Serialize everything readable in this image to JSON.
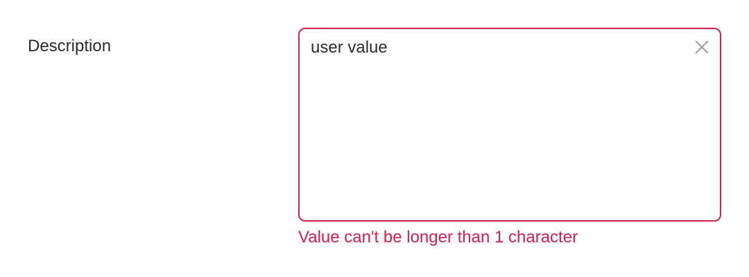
{
  "form": {
    "description": {
      "label": "Description",
      "value": "user value",
      "clear_icon": "close-icon",
      "error": "Value can't be longer than 1 character"
    }
  },
  "colors": {
    "error": "#d61e4d",
    "text": "#2a2a2a",
    "icon": "#a8a8a8"
  }
}
